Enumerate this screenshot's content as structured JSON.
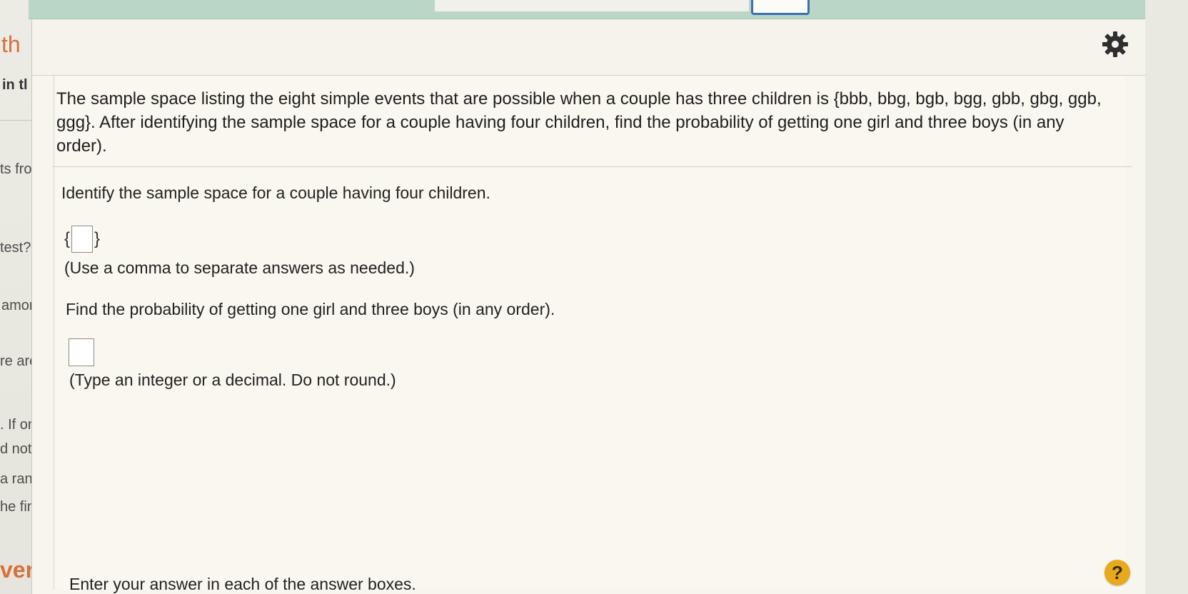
{
  "background_page": {
    "fragments": [
      "th",
      "in tl",
      "ts fro",
      "test? r",
      "amon",
      "re are",
      ". If one",
      "d not u",
      "a rando",
      "he final",
      "ver"
    ]
  },
  "icons": {
    "settings": "gear-icon",
    "help": "help-icon"
  },
  "colors": {
    "accent_blue": "#3d6fb6",
    "top_strip": "#b9d6c6",
    "help_button": "#e8a91c",
    "background_orange_text": "#d4713c"
  },
  "question": {
    "text": "The sample space listing the eight simple events that are possible when a couple has three children is {bbb, bbg, bgb, bgg, gbb, gbg, ggb, ggg}. After identifying the sample space for a couple having four children, find the probability of getting one girl and three boys (in any order)."
  },
  "part1": {
    "prompt": "Identify the sample space for a couple having four children.",
    "open_brace": "{",
    "close_brace": "}",
    "answer": "",
    "hint": "(Use a comma to separate answers as needed.)"
  },
  "part2": {
    "prompt": "Find the probability of getting one girl and three boys (in any order).",
    "answer": "",
    "hint": "(Type an integer or a decimal. Do not round.)"
  },
  "footer": {
    "instruction": "Enter your answer in each of the answer boxes.",
    "help_label": "?"
  }
}
